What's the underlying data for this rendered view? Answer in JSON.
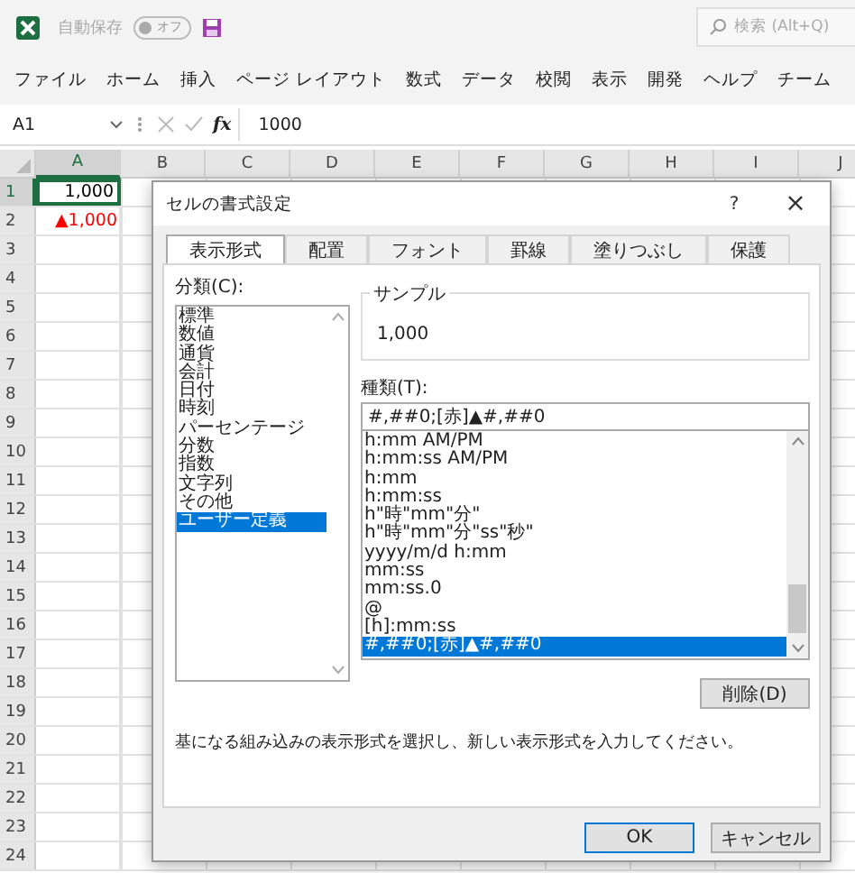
{
  "titlebar": {
    "autosave_label": "自動保存",
    "autosave_toggle": {
      "label": "オフ",
      "on": false
    },
    "search": {
      "placeholder": "検索 (Alt+Q)"
    }
  },
  "menu": [
    "ファイル",
    "ホーム",
    "挿入",
    "ページ レイアウト",
    "数式",
    "データ",
    "校閲",
    "表示",
    "開発",
    "ヘルプ",
    "チーム"
  ],
  "formula_bar": {
    "name_box": "A1",
    "fx": "fx",
    "formula": "1000"
  },
  "sheet": {
    "columns": [
      {
        "label": "A",
        "selected": true
      },
      {
        "label": "B",
        "selected": false
      },
      {
        "label": "C",
        "selected": false
      },
      {
        "label": "D",
        "selected": false
      },
      {
        "label": "E",
        "selected": false
      },
      {
        "label": "F",
        "selected": false
      },
      {
        "label": "G",
        "selected": false
      },
      {
        "label": "H",
        "selected": false
      },
      {
        "label": "I",
        "selected": false
      },
      {
        "label": "J",
        "selected": false
      }
    ],
    "rows": [
      {
        "number": "1",
        "selected": true,
        "cells": [
          {
            "text": "1,000",
            "color": "#000000",
            "selected": true
          }
        ]
      },
      {
        "number": "2",
        "selected": false,
        "cells": [
          {
            "text": "▲1,000",
            "color": "#ff0000",
            "selected": false
          }
        ]
      },
      {
        "number": "3",
        "selected": false
      },
      {
        "number": "4",
        "selected": false
      },
      {
        "number": "5",
        "selected": false
      },
      {
        "number": "6",
        "selected": false
      },
      {
        "number": "7",
        "selected": false
      },
      {
        "number": "8",
        "selected": false
      },
      {
        "number": "9",
        "selected": false
      },
      {
        "number": "10",
        "selected": false
      },
      {
        "number": "11",
        "selected": false
      },
      {
        "number": "12",
        "selected": false
      },
      {
        "number": "13",
        "selected": false
      },
      {
        "number": "14",
        "selected": false
      },
      {
        "number": "15",
        "selected": false
      },
      {
        "number": "16",
        "selected": false
      },
      {
        "number": "17",
        "selected": false
      },
      {
        "number": "18",
        "selected": false
      },
      {
        "number": "19",
        "selected": false
      },
      {
        "number": "20",
        "selected": false
      },
      {
        "number": "21",
        "selected": false
      },
      {
        "number": "22",
        "selected": false
      },
      {
        "number": "23",
        "selected": false
      },
      {
        "number": "24",
        "selected": false
      }
    ]
  },
  "dialog": {
    "title": "セルの書式設定",
    "help": "?",
    "close": "×",
    "tabs": [
      {
        "label": "表示形式",
        "selected": true
      },
      {
        "label": "配置",
        "selected": false
      },
      {
        "label": "フォント",
        "selected": false
      },
      {
        "label": "罫線",
        "selected": false
      },
      {
        "label": "塗りつぶし",
        "selected": false
      },
      {
        "label": "保護",
        "selected": false
      }
    ],
    "category_label": "分類(C):",
    "categories": [
      {
        "label": "標準",
        "selected": false
      },
      {
        "label": "数値",
        "selected": false
      },
      {
        "label": "通貨",
        "selected": false
      },
      {
        "label": "会計",
        "selected": false
      },
      {
        "label": "日付",
        "selected": false
      },
      {
        "label": "時刻",
        "selected": false
      },
      {
        "label": "パーセンテージ",
        "selected": false
      },
      {
        "label": "分数",
        "selected": false
      },
      {
        "label": "指数",
        "selected": false
      },
      {
        "label": "文字列",
        "selected": false
      },
      {
        "label": "その他",
        "selected": false
      },
      {
        "label": "ユーザー定義",
        "selected": true
      }
    ],
    "sample_label": "サンプル",
    "sample_value": "1,000",
    "type_label": "種類(T):",
    "type_value": "#,##0;[赤]▲#,##0",
    "formats": [
      {
        "label": "h:mm AM/PM",
        "selected": false
      },
      {
        "label": "h:mm:ss AM/PM",
        "selected": false
      },
      {
        "label": "h:mm",
        "selected": false
      },
      {
        "label": "h:mm:ss",
        "selected": false
      },
      {
        "label": "h\"時\"mm\"分\"",
        "selected": false
      },
      {
        "label": "h\"時\"mm\"分\"ss\"秒\"",
        "selected": false
      },
      {
        "label": "yyyy/m/d h:mm",
        "selected": false
      },
      {
        "label": "mm:ss",
        "selected": false
      },
      {
        "label": "mm:ss.0",
        "selected": false
      },
      {
        "label": "@",
        "selected": false
      },
      {
        "label": "[h]:mm:ss",
        "selected": false
      },
      {
        "label": "#,##0;[赤]▲#,##0",
        "selected": true
      }
    ],
    "delete_button": "削除(D)",
    "hint": "基になる組み込みの表示形式を選択し、新しい表示形式を入力してください。",
    "ok": "OK",
    "cancel": "キャンセル"
  }
}
